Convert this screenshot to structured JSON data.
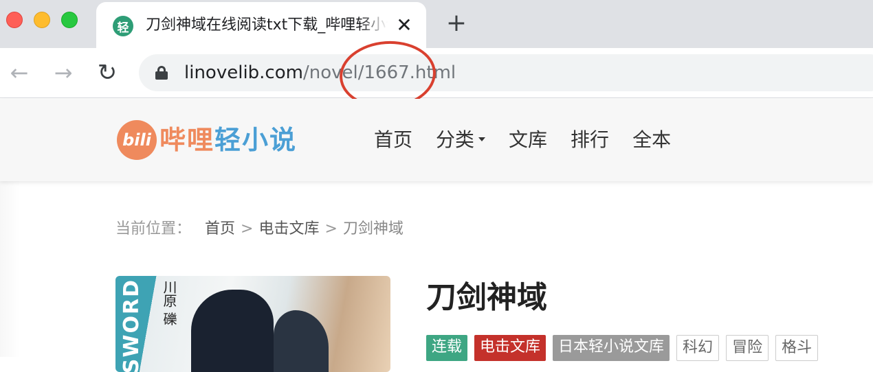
{
  "browser": {
    "tab": {
      "favicon_text": "轻",
      "title": "刀剑神域在线阅读txt下载_哔哩轻小说",
      "close_glyph": "✕"
    },
    "new_tab_glyph": "+",
    "toolbar": {
      "back_glyph": "←",
      "forward_glyph": "→",
      "reload_glyph": "↻"
    },
    "url": {
      "domain": "linovelib.com",
      "path": "/novel/1667.html"
    },
    "annotation_color": "#d9402f"
  },
  "site": {
    "logo": {
      "badge_text": "bili",
      "name_part1": "哔哩",
      "name_part2": "轻小说"
    },
    "nav": [
      "首页",
      "分类",
      "文库",
      "排行",
      "全本"
    ]
  },
  "breadcrumb": {
    "label": "当前位置：",
    "items": [
      "首页",
      "电击文库"
    ],
    "separator": ">",
    "current": "刀剑神域"
  },
  "book": {
    "cover": {
      "spine_text": "SWORD",
      "author_text": "川原 礫"
    },
    "title": "刀剑神域",
    "tags": [
      {
        "label": "连载",
        "style": "green",
        "color": "#3ea683"
      },
      {
        "label": "电击文库",
        "style": "red",
        "color": "#c4312b"
      },
      {
        "label": "日本轻小说文库",
        "style": "gray",
        "color": "#9a9a9a"
      },
      {
        "label": "科幻",
        "style": "outline"
      },
      {
        "label": "冒险",
        "style": "outline"
      },
      {
        "label": "格斗",
        "style": "outline"
      }
    ]
  }
}
